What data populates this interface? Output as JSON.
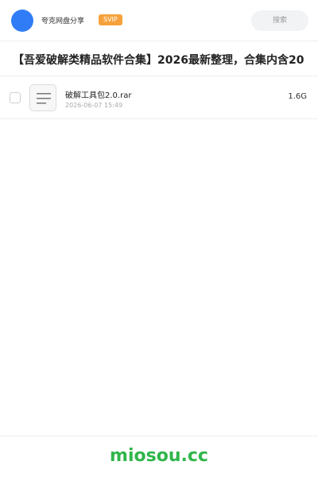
{
  "header": {
    "username": "夸克网盘分享",
    "badge": "SVIP",
    "search_label": "搜索",
    "colors": {
      "avatar": "#2f7cf6",
      "badge": "#f6a23c"
    }
  },
  "share": {
    "title": "【吾爱破解类精品软件合集】2026最新整理，合集内含20"
  },
  "files": [
    {
      "name": "破解工具包2.0.rar",
      "date": "2026-06-07 15:49",
      "size": "1.6G",
      "icon": "file-list-icon"
    }
  ],
  "footer": {
    "brand": "miosou.cc",
    "brand_color": "#2fb64a"
  }
}
